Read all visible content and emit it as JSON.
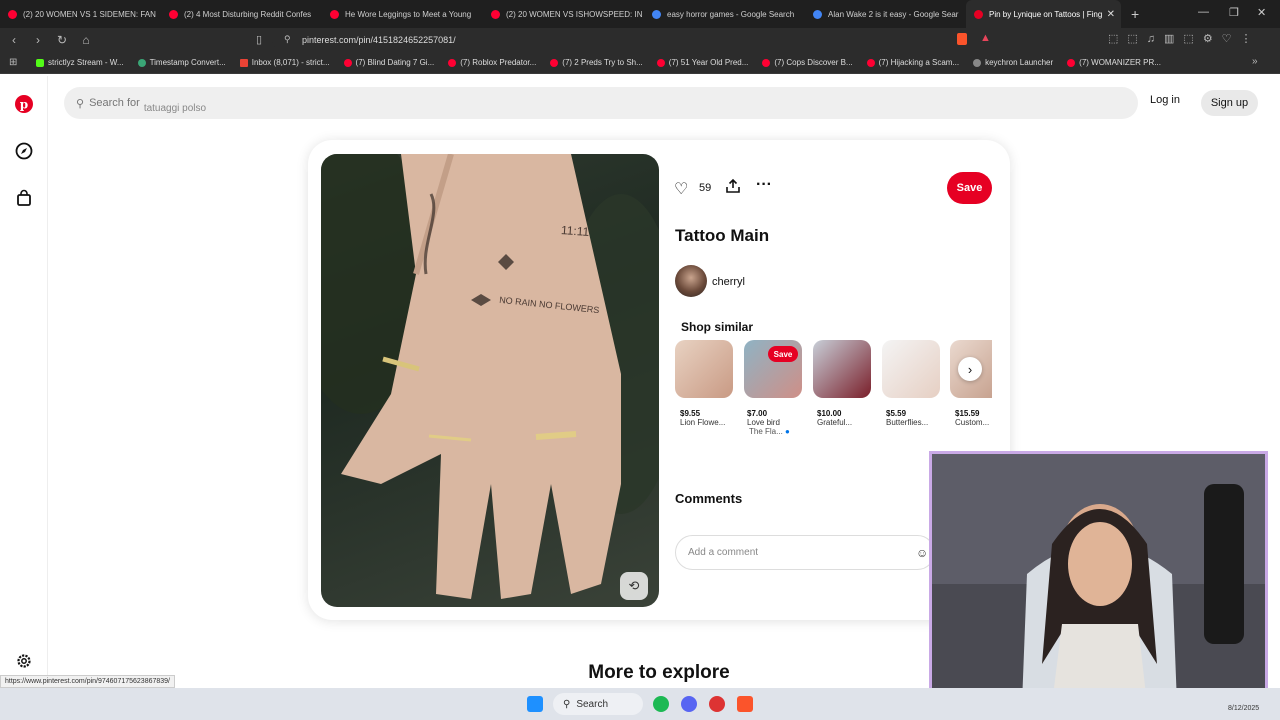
{
  "browser": {
    "tabs": [
      {
        "title": "(2) 20 WOMEN VS 1 SIDEMEN: FAN",
        "color": "#ff0033"
      },
      {
        "title": "(2) 4 Most Disturbing Reddit Confes",
        "color": "#ff0033"
      },
      {
        "title": "He Wore Leggings to Meet a Young",
        "color": "#ff0033"
      },
      {
        "title": "(2) 20 WOMEN VS ISHOWSPEED: IN",
        "color": "#ff0033"
      },
      {
        "title": "easy horror games - Google Search",
        "color": "#4285f4"
      },
      {
        "title": "Alan Wake 2 is it easy - Google Sear",
        "color": "#4285f4"
      },
      {
        "title": "Pin by Lynique on Tattoos | Fing",
        "color": "#e60023"
      }
    ],
    "url": "pinterest.com/pin/4151824652257081/",
    "bookmarks": [
      "strictlyz Stream - W...",
      "Timestamp Convert...",
      "Inbox (8,071) - strict...",
      "(7) Blind Dating 7 Gi...",
      "(7) Roblox Predator...",
      "(7) 2 Preds Try to Sh...",
      "(7) 51 Year Old Pred...",
      "(7) Cops Discover B...",
      "(7) Hijacking a Scam...",
      "keychron Launcher",
      "(7) WOMANIZER PR..."
    ],
    "status_url": "https://www.pinterest.com/pin/974607175623867839/"
  },
  "header": {
    "search_label": "Search for",
    "search_suggestion": "tatuaggi polso",
    "login": "Log in",
    "signup": "Sign up"
  },
  "pin": {
    "likes": "59",
    "save": "Save",
    "title": "Tattoo Main",
    "creator": "cherryl",
    "image_text_1": "11:11",
    "image_text_2": "NO RAIN NO FLOWERS",
    "shop_heading": "Shop similar",
    "shop_items": [
      {
        "price": "$9.55",
        "name": "Lion Flowe..."
      },
      {
        "price": "$7.00",
        "name": "Love bird",
        "seller": "The Fla...",
        "hover_save": "Save"
      },
      {
        "price": "$10.00",
        "name": "Grateful..."
      },
      {
        "price": "$5.59",
        "name": "Butterflies..."
      },
      {
        "price": "$15.59",
        "name": "Custom..."
      }
    ],
    "comments_heading": "Comments",
    "comment_placeholder": "Add a comment"
  },
  "more_to_explore": "More to explore",
  "taskbar": {
    "search": "Search",
    "date": "8/12/2025"
  },
  "colors": {
    "brand": "#e60023"
  }
}
